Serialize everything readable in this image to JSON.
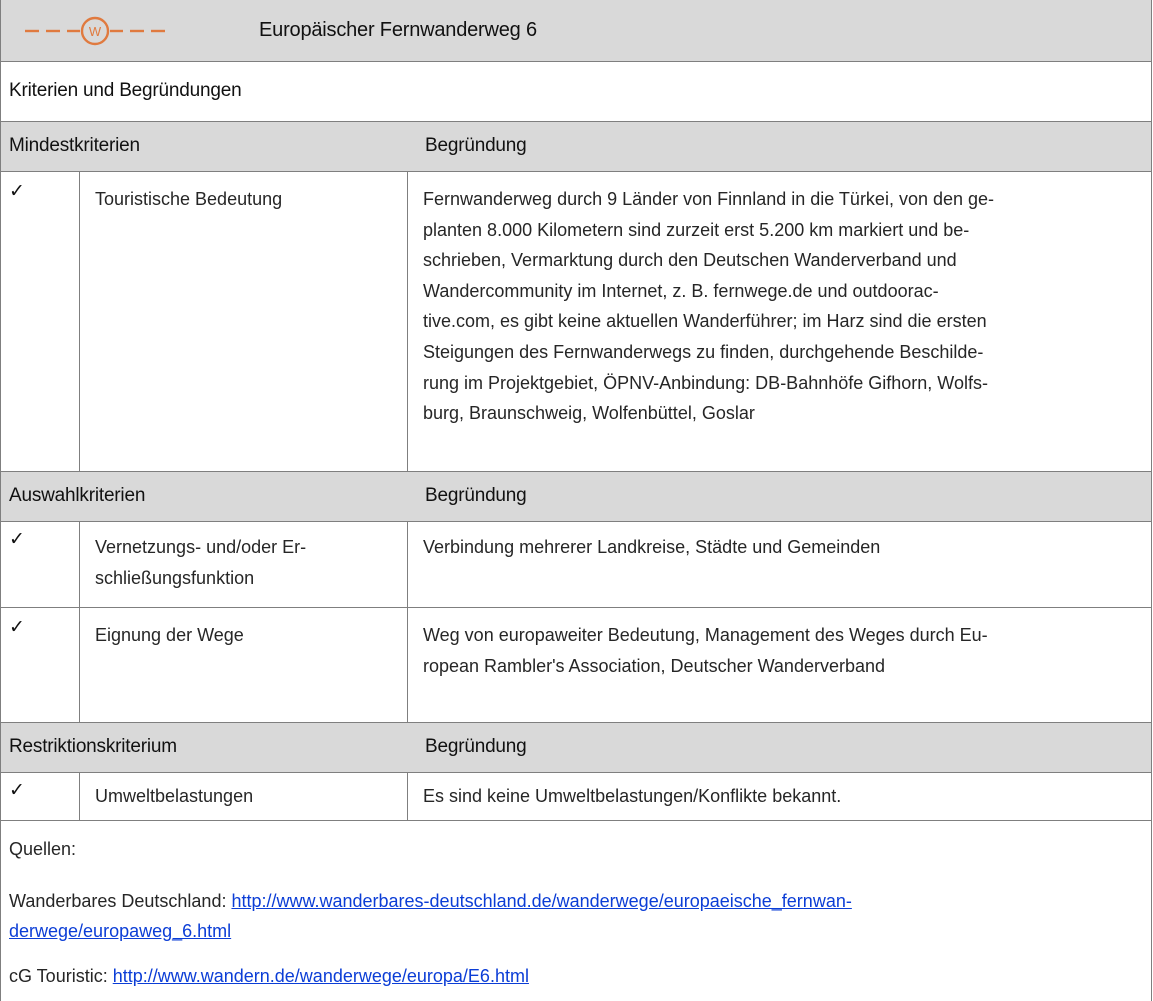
{
  "title_row": {
    "logo_letter": "W",
    "title": "Europäischer Fernwanderweg 6",
    "accent_color": "#e07a3f"
  },
  "section_title": "Kriterien und Begründungen",
  "groups": [
    {
      "header_left": "Mindestkriterien",
      "header_right": "Begründung",
      "rows": [
        {
          "check": "✓",
          "criterion": [
            "Touristische Bedeutung"
          ],
          "reason": [
            "Fernwanderweg durch 9 Länder von Finnland in die Türkei, von den ge-",
            "planten 8.000 Kilometern sind zurzeit erst 5.200 km markiert und be-",
            "schrieben, Vermarktung durch den Deutschen Wanderverband  und",
            "Wandercommunity im Internet, z. B. fernwege.de und outdoorac-",
            "tive.com, es gibt keine aktuellen Wanderführer; im Harz sind die ersten",
            "Steigungen des Fernwanderwegs zu finden, durchgehende Beschilde-",
            "rung im Projektgebiet, ÖPNV-Anbindung: DB-Bahnhöfe Gifhorn, Wolfs-",
            "burg, Braunschweig, Wolfenbüttel, Goslar"
          ]
        }
      ]
    },
    {
      "header_left": "Auswahlkriterien",
      "header_right": "Begründung",
      "rows": [
        {
          "check": "✓",
          "criterion": [
            "Vernetzungs- und/oder Er-",
            "schließungsfunktion"
          ],
          "reason": [
            "Verbindung mehrerer Landkreise, Städte und Gemeinden"
          ]
        },
        {
          "check": "✓",
          "criterion": [
            "Eignung der Wege"
          ],
          "reason": [
            "Weg von europaweiter Bedeutung, Management des Weges durch Eu-",
            "ropean Rambler's Association, Deutscher Wanderverband"
          ]
        }
      ]
    },
    {
      "header_left": "Restriktionskriterium",
      "header_right": "Begründung",
      "rows": [
        {
          "check": "✓",
          "criterion": [
            "Umweltbelastungen"
          ],
          "reason": [
            "Es sind keine Umweltbelastungen/Konflikte bekannt."
          ]
        }
      ]
    }
  ],
  "sources": {
    "heading": "Quellen:",
    "entries": [
      {
        "label": "Wanderbares Deutschland: ",
        "url_line1": "http://www.wanderbares-deutschland.de/wanderwege/europaeische_fernwan-",
        "url_line2": "derwege/europaweg_6.html"
      },
      {
        "label": "cG Touristic: ",
        "url_line1": "http://www.wandern.de/wanderwege/europa/E6.html"
      }
    ]
  }
}
